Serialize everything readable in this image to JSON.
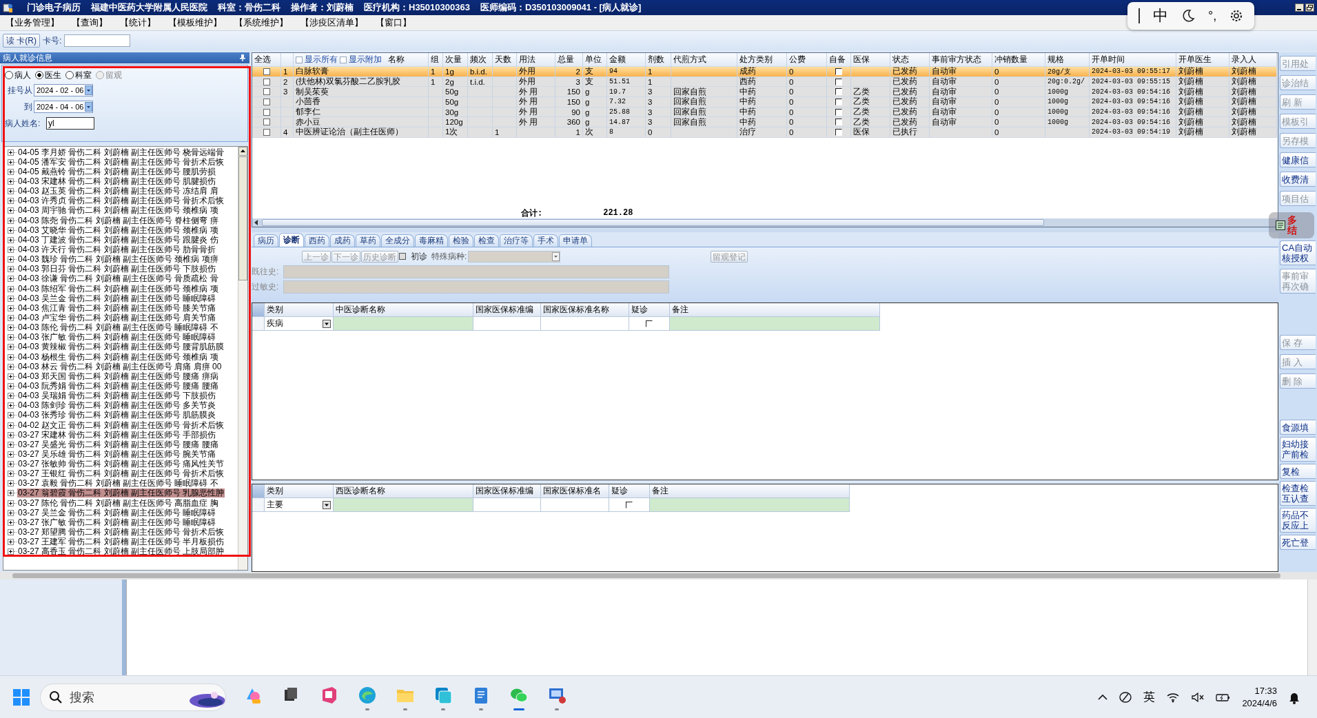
{
  "title_bar": {
    "parts": [
      "门诊电子病历",
      "福建中医药大学附属人民医院",
      "科室：骨伤二科",
      "操作者：刘蔚楠",
      "医疗机构：H35010300363",
      "医师编码：D350103009041 - [病人就诊]"
    ]
  },
  "ime_bar": {
    "items": [
      "中",
      "°,"
    ]
  },
  "menu": [
    "【业务管理】",
    "【查询】",
    "【统计】",
    "【模板维护】",
    "【系统维护】",
    "【涉疫区清单】",
    "【窗口】"
  ],
  "card_reader": {
    "button": "读 卡(R)",
    "label": "卡号:"
  },
  "patient_panel": {
    "title": "病人就诊信息",
    "filters": [
      {
        "label": "病人",
        "selected": false,
        "disabled": false
      },
      {
        "label": "医生",
        "selected": true,
        "disabled": false
      },
      {
        "label": "科室",
        "selected": false,
        "disabled": false
      },
      {
        "label": "留观",
        "selected": false,
        "disabled": true
      }
    ],
    "date_from": {
      "label": "挂号从",
      "value": "2024 - 02 - 06"
    },
    "date_to": {
      "label": "到",
      "value": "2024 - 04 - 06"
    },
    "name_field": {
      "label": "病人姓名:",
      "value": "yl"
    },
    "visits": [
      {
        "text": "04-05 李月娇 骨伤二科 刘蔚楠 副主任医师号 桡骨远端骨",
        "selected": false
      },
      {
        "text": "04-05 潘军安 骨伤二科 刘蔚楠 副主任医师号 骨折术后恢",
        "selected": false
      },
      {
        "text": "04-05 戴燕铃 骨伤二科 刘蔚楠 副主任医师号 腰肌劳损",
        "selected": false
      },
      {
        "text": "04-03 宋建林 骨伤二科 刘蔚楠 副主任医师号 肌腱损伤",
        "selected": false
      },
      {
        "text": "04-03 赵玉英 骨伤二科 刘蔚楠 副主任医师号 冻结肩 肩",
        "selected": false
      },
      {
        "text": "04-03 许秀贞 骨伤二科 刘蔚楠 副主任医师号 骨折术后恢",
        "selected": false
      },
      {
        "text": "04-03 周宇驰 骨伤二科 刘蔚楠 副主任医师号 颈椎病 项",
        "selected": false
      },
      {
        "text": "04-03 陈尧 骨伤二科 刘蔚楠 副主任医师号 脊柱侧弯 痹",
        "selected": false
      },
      {
        "text": "04-03 艾晓华 骨伤二科 刘蔚楠 副主任医师号 颈椎病 项",
        "selected": false
      },
      {
        "text": "04-03 丁建波 骨伤二科 刘蔚楠 副主任医师号 跟腱炎 伤",
        "selected": false
      },
      {
        "text": "04-03 许天行 骨伤二科 刘蔚楠 副主任医师号 肋骨骨折",
        "selected": false
      },
      {
        "text": "04-03 魏珍 骨伤二科 刘蔚楠 副主任医师号 颈椎病 项痹",
        "selected": false
      },
      {
        "text": "04-03 郭日芬 骨伤二科 刘蔚楠 副主任医师号 下肢损伤",
        "selected": false
      },
      {
        "text": "04-03 徐谦 骨伤二科 刘蔚楠 副主任医师号 骨质疏松 骨",
        "selected": false
      },
      {
        "text": "04-03 陈绍军 骨伤二科 刘蔚楠 副主任医师号 颈椎病 项",
        "selected": false
      },
      {
        "text": "04-03 吴兰金 骨伤二科 刘蔚楠 副主任医师号 睡眠障碍",
        "selected": false
      },
      {
        "text": "04-03 焦江青 骨伤二科 刘蔚楠 副主任医师号 膝关节痛",
        "selected": false
      },
      {
        "text": "04-03 卢宝华 骨伤二科 刘蔚楠 副主任医师号 肩关节痛",
        "selected": false
      },
      {
        "text": "04-03 陈伦 骨伤二科 刘蔚楠 副主任医师号 睡眠障碍 不",
        "selected": false
      },
      {
        "text": "04-03 张广敏 骨伤二科 刘蔚楠 副主任医师号 睡眠障碍",
        "selected": false
      },
      {
        "text": "04-03 黄辣椒 骨伤二科 刘蔚楠 副主任医师号 腰背肌筋膜",
        "selected": false
      },
      {
        "text": "04-03 杨根生 骨伤二科 刘蔚楠 副主任医师号 颈椎病 项",
        "selected": false
      },
      {
        "text": "04-03 林云 骨伤二科 刘蔚楠 副主任医师号 肩痛 肩痹 00",
        "selected": false
      },
      {
        "text": "04-03 郑天国 骨伤二科 刘蔚楠 副主任医师号 腰痛 痹病",
        "selected": false
      },
      {
        "text": "04-03 阮秀娟 骨伤二科 刘蔚楠 副主任医师号 腰痛 腰痛",
        "selected": false
      },
      {
        "text": "04-03 吴瑞娟 骨伤二科 刘蔚楠 副主任医师号 下肢损伤",
        "selected": false
      },
      {
        "text": "04-03 陈剑珍 骨伤二科 刘蔚楠 副主任医师号 多关节炎",
        "selected": false
      },
      {
        "text": "04-03 张秀珍 骨伤二科 刘蔚楠 副主任医师号 肌筋膜炎",
        "selected": false
      },
      {
        "text": "04-02 赵文正 骨伤二科 刘蔚楠 副主任医师号 骨折术后恢",
        "selected": false
      },
      {
        "text": "03-27 宋建林 骨伤二科 刘蔚楠 副主任医师号 手部损伤",
        "selected": false
      },
      {
        "text": "03-27 吴盛光 骨伤二科 刘蔚楠 副主任医师号 腰痛 腰痛",
        "selected": false
      },
      {
        "text": "03-27 吴乐雄 骨伤二科 刘蔚楠 副主任医师号 腕关节痛",
        "selected": false
      },
      {
        "text": "03-27 张敏帅 骨伤二科 刘蔚楠 副主任医师号 痛风性关节",
        "selected": false
      },
      {
        "text": "03-27 王银红 骨伤二科 刘蔚楠 副主任医师号 骨折术后恢",
        "selected": false
      },
      {
        "text": "03-27 袁毅 骨伤二科 刘蔚楠 副主任医师号 睡眠障碍 不",
        "selected": false
      },
      {
        "text": "03-27 翁碧霞 骨伤二科 刘蔚楠 副主任医师号 乳腺恶性肿",
        "selected": true
      },
      {
        "text": "03-27 陈伦 骨伤二科 刘蔚楠 副主任医师号 高脂血症 胸",
        "selected": false
      },
      {
        "text": "03-27 吴兰金 骨伤二科 刘蔚楠 副主任医师号 睡眠障碍",
        "selected": false
      },
      {
        "text": "03-27 张广敏 骨伤二科 刘蔚楠 副主任医师号 睡眠障碍",
        "selected": false
      },
      {
        "text": "03-27 郑望腾 骨伤二科 刘蔚楠 副主任医师号 骨折术后恢",
        "selected": false
      },
      {
        "text": "03-27 王建军 骨伤二科 刘蔚楠 副主任医师号 半月板损伤",
        "selected": false
      },
      {
        "text": "03-27 高香玉 骨伤二科 刘蔚楠 副主任医师号 上肢局部肿",
        "selected": false
      }
    ]
  },
  "prescriptions": {
    "select_all": "全选",
    "show_all": {
      "label": "显示所有",
      "checked": false
    },
    "show_extra": {
      "label": "显示附加",
      "checked": false
    },
    "name_header": "名称",
    "columns": [
      "组",
      "次量",
      "频次",
      "天数",
      "用法",
      "总量",
      "单位",
      "金额",
      "剂数",
      "代煎方式",
      "处方类别",
      "公费",
      "自备",
      "医保",
      "状态",
      "事前审方状态",
      "冲销数量",
      "规格",
      "开单时间",
      "开单医生",
      "录入人"
    ],
    "rows": [
      {
        "checked": false,
        "selected": true,
        "no": "1",
        "name": "白脉软膏",
        "self_supplied": false,
        "cells": [
          "1",
          "1g",
          "b.i.d.",
          null,
          "外用",
          "2",
          "支",
          "94",
          "1",
          null,
          "成药",
          "0",
          null,
          null,
          "已发药",
          "自动审",
          "0",
          "20g/支",
          "2024-03-03 09:55:17",
          "刘蔚楠",
          "刘蔚楠"
        ]
      },
      {
        "checked": false,
        "selected": false,
        "no": "2",
        "name": "(扶他林)双氯芬酸二乙胺乳胶",
        "self_supplied": false,
        "cells": [
          "1",
          "2g",
          "t.i.d.",
          null,
          "外用",
          "3",
          "支",
          "51.51",
          "1",
          null,
          "西药",
          "0",
          null,
          null,
          "已发药",
          "自动审",
          "0",
          "20g:0.2g/",
          "2024-03-03 09:55:15",
          "刘蔚楠",
          "刘蔚楠"
        ]
      },
      {
        "checked": false,
        "selected": false,
        "no": "3",
        "name": "制吴茱萸",
        "self_supplied": false,
        "cells": [
          null,
          "50g",
          null,
          null,
          "外 用",
          "150",
          "g",
          "19.7",
          "3",
          "回家自煎",
          "中药",
          "0",
          null,
          "乙类",
          "已发药",
          "自动审",
          "0",
          "1000g",
          "2024-03-03 09:54:16",
          "刘蔚楠",
          "刘蔚楠"
        ]
      },
      {
        "checked": false,
        "selected": false,
        "name": "小茴香",
        "self_supplied": false,
        "cells": [
          null,
          "50g",
          null,
          null,
          "外 用",
          "150",
          "g",
          "7.32",
          "3",
          "回家自煎",
          "中药",
          "0",
          null,
          "乙类",
          "已发药",
          "自动审",
          "0",
          "1000g",
          "2024-03-03 09:54:16",
          "刘蔚楠",
          "刘蔚楠"
        ]
      },
      {
        "checked": false,
        "selected": false,
        "name": "郁李仁",
        "self_supplied": false,
        "cells": [
          null,
          "30g",
          null,
          null,
          "外 用",
          "90",
          "g",
          "25.88",
          "3",
          "回家自煎",
          "中药",
          "0",
          null,
          "乙类",
          "已发药",
          "自动审",
          "0",
          "1000g",
          "2024-03-03 09:54:16",
          "刘蔚楠",
          "刘蔚楠"
        ]
      },
      {
        "checked": false,
        "selected": false,
        "name": "赤小豆",
        "self_supplied": false,
        "cells": [
          null,
          "120g",
          null,
          null,
          "外 用",
          "360",
          "g",
          "14.87",
          "3",
          "回家自煎",
          "中药",
          "0",
          null,
          "乙类",
          "已发药",
          "自动审",
          "0",
          "1000g",
          "2024-03-03 09:54:16",
          "刘蔚楠",
          "刘蔚楠"
        ]
      },
      {
        "checked": false,
        "selected": false,
        "no": "4",
        "name": "中医辨证论治（副主任医师）",
        "self_supplied": false,
        "cells": [
          null,
          "1次",
          null,
          "1",
          null,
          "1",
          "次",
          "8",
          "0",
          null,
          "治疗",
          "0",
          null,
          "医保",
          "已执行",
          null,
          "0",
          null,
          "2024-03-03 09:54:19",
          "刘蔚楠",
          "刘蔚楠"
        ]
      }
    ],
    "total_label": "合计:",
    "total": "221.28"
  },
  "tabs": [
    {
      "label": "病历",
      "selected": false
    },
    {
      "label": "诊断",
      "selected": true
    },
    {
      "label": "西药",
      "selected": false
    },
    {
      "label": "成药",
      "selected": false
    },
    {
      "label": "草药",
      "selected": false
    },
    {
      "label": "全成分",
      "selected": false
    },
    {
      "label": "毒麻精",
      "selected": false
    },
    {
      "label": "检验",
      "selected": false
    },
    {
      "label": "检查",
      "selected": false
    },
    {
      "label": "治疗等",
      "selected": false
    },
    {
      "label": "手术",
      "selected": false
    },
    {
      "label": "申请单",
      "selected": false
    }
  ],
  "diagnosis_toolbar": {
    "buttons": [
      {
        "label": "上一诊",
        "disabled": true
      },
      {
        "label": "下一诊",
        "disabled": true
      },
      {
        "label": "历史诊断",
        "disabled": true
      }
    ],
    "first_visit": {
      "label": "初诊",
      "checked": false
    },
    "special_label": "特殊病种:",
    "observe_button": {
      "label": "留观登记",
      "disabled": true
    }
  },
  "history": [
    {
      "label": "既往史:"
    },
    {
      "label": "过敏史:"
    }
  ],
  "tcm_grid": {
    "columns": [
      "类别",
      "中医诊断名称",
      "国家医保标准编",
      "国家医保标准名称",
      "疑诊",
      "备注"
    ],
    "rows": [
      {
        "category": "疾病",
        "suspected": false
      }
    ]
  },
  "western_grid": {
    "columns": [
      "类别",
      "西医诊断名称",
      "国家医保标准编",
      "国家医保标准名",
      "疑诊",
      "备注"
    ],
    "rows": [
      {
        "category": "主要",
        "suspected": false
      }
    ]
  },
  "side_groups": [
    {
      "buttons": [
        {
          "lines": [
            "引用处"
          ],
          "disabled": true
        },
        {
          "lines": [
            "诊治结"
          ],
          "disabled": true
        },
        {
          "lines": [
            "刷 新"
          ],
          "disabled": true
        },
        {
          "lines": [
            "模板引"
          ],
          "disabled": true
        },
        {
          "lines": [
            "另存模"
          ],
          "disabled": true
        },
        {
          "lines": [
            "健康信"
          ],
          "disabled": false
        },
        {
          "lines": [
            "收费清"
          ],
          "disabled": false
        },
        {
          "lines": [
            "项目估"
          ],
          "disabled": true
        }
      ]
    },
    {
      "buttons": [
        {
          "lines": [
            "CA自动",
            "核授权"
          ],
          "disabled": false
        },
        {
          "lines": [
            "事前审",
            "再次确"
          ],
          "disabled": true
        }
      ]
    },
    {
      "buttons": [
        {
          "lines": [
            "保 存"
          ],
          "disabled": true
        },
        {
          "lines": [
            "插 入"
          ],
          "disabled": true
        },
        {
          "lines": [
            "删 除"
          ],
          "disabled": true
        }
      ]
    },
    {
      "buttons": [
        {
          "lines": [
            "食源填"
          ],
          "disabled": false
        },
        {
          "lines": [
            "妇幼接",
            "产前检"
          ],
          "disabled": false
        },
        {
          "lines": [
            "复检"
          ],
          "disabled": false
        },
        {
          "lines": [
            "检查检",
            "互认查"
          ],
          "disabled": false
        },
        {
          "lines": [
            "药品不",
            "反应上"
          ],
          "disabled": false
        },
        {
          "lines": [
            "死亡登"
          ],
          "disabled": false
        }
      ]
    }
  ],
  "floating_widget": {
    "lines": [
      "多",
      "结"
    ]
  },
  "taskbar": {
    "search_placeholder": "搜索",
    "apps": [
      {
        "kind": "copilot",
        "running": false,
        "selected": false
      },
      {
        "kind": "taskview",
        "running": false,
        "selected": false
      },
      {
        "kind": "office",
        "running": false,
        "selected": false
      },
      {
        "kind": "edge",
        "running": true,
        "selected": false
      },
      {
        "kind": "folder",
        "running": true,
        "selected": false
      },
      {
        "kind": "teal",
        "running": true,
        "selected": false
      },
      {
        "kind": "notepad",
        "running": true,
        "selected": false
      },
      {
        "kind": "wechat",
        "running": true,
        "selected": true
      },
      {
        "kind": "remote",
        "running": true,
        "selected": false
      }
    ],
    "ime": "英",
    "time": "17:33",
    "date": "2024/4/6"
  }
}
